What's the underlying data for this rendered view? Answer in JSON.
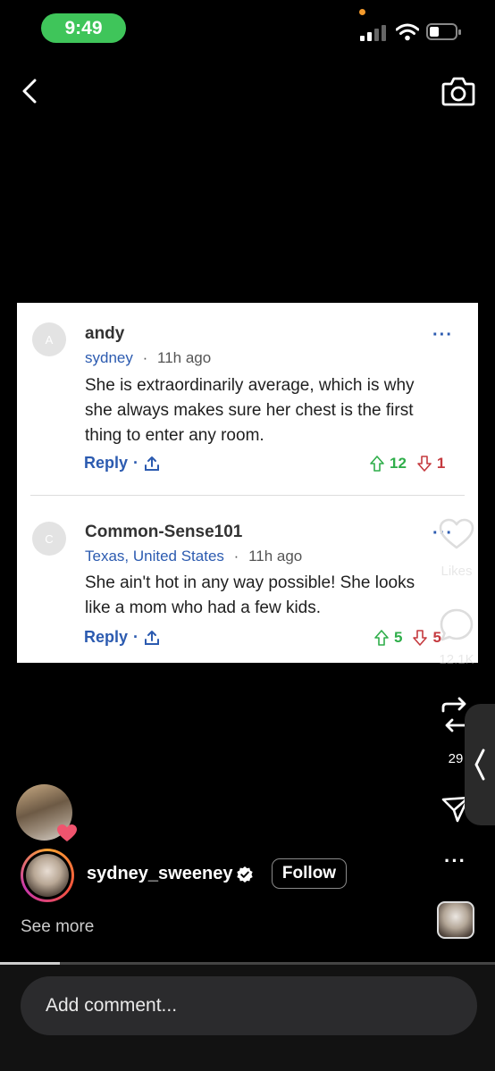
{
  "status": {
    "time": "9:49"
  },
  "comments": [
    {
      "avatar_letter": "A",
      "name": "andy",
      "location": "sydney",
      "time": "11h ago",
      "body_lines": [
        "She is extraordinarily average, which is why",
        "she always makes sure her chest is the first",
        "thing to enter any room."
      ],
      "reply_label": "Reply",
      "upvotes": "12",
      "downvotes": "1"
    },
    {
      "avatar_letter": "C",
      "name": "Common-Sense101",
      "location": "Texas, United States",
      "time": "11h ago",
      "body_lines": [
        "She ain't hot in any way possible!  She looks",
        "like a mom who had a few kids."
      ],
      "reply_label": "Reply",
      "upvotes": "5",
      "downvotes": "5"
    }
  ],
  "rail": {
    "likes_label": "Likes",
    "comments_count": "12.1K",
    "reposts_count": "29"
  },
  "profile": {
    "username": "sydney_sweeney",
    "follow_label": "Follow",
    "see_more": "See more"
  },
  "comment_input": {
    "placeholder": "Add comment..."
  },
  "colors": {
    "accent_blue": "#2c5bb0",
    "upvote": "#2fae4a",
    "downvote": "#c53a3f",
    "time_pill": "#3fc55a"
  }
}
